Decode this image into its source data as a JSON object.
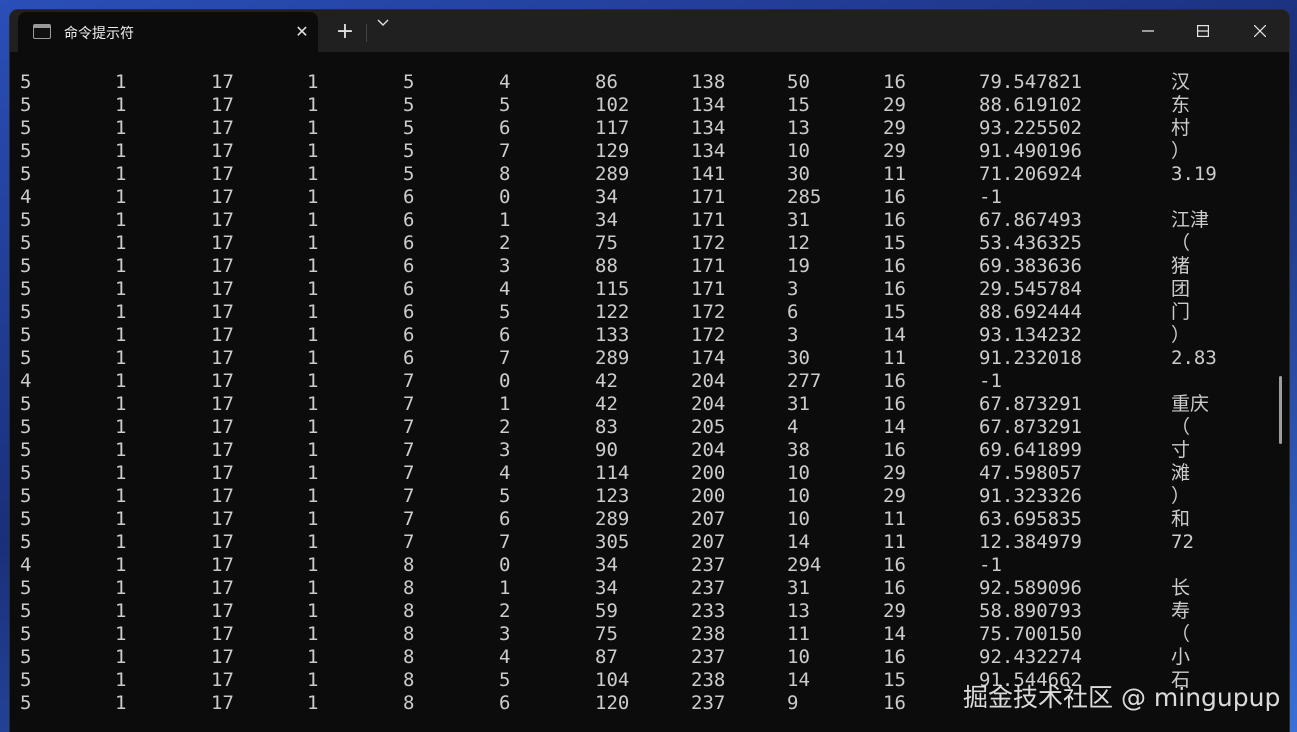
{
  "window": {
    "tab_title": "命令提示符",
    "new_tab": "+"
  },
  "watermark": "掘金技术社区 @ mingupup",
  "rows": [
    [
      "5",
      "1",
      "17",
      "1",
      "5",
      "4",
      "86",
      "138",
      "50",
      "16",
      "79.547821",
      "汉"
    ],
    [
      "5",
      "1",
      "17",
      "1",
      "5",
      "5",
      "102",
      "134",
      "15",
      "29",
      "88.619102",
      "东"
    ],
    [
      "5",
      "1",
      "17",
      "1",
      "5",
      "6",
      "117",
      "134",
      "13",
      "29",
      "93.225502",
      "村"
    ],
    [
      "5",
      "1",
      "17",
      "1",
      "5",
      "7",
      "129",
      "134",
      "10",
      "29",
      "91.490196",
      "）"
    ],
    [
      "5",
      "1",
      "17",
      "1",
      "5",
      "8",
      "289",
      "141",
      "30",
      "11",
      "71.206924",
      "3.19"
    ],
    [
      "4",
      "1",
      "17",
      "1",
      "6",
      "0",
      "34",
      "171",
      "285",
      "16",
      "-1",
      ""
    ],
    [
      "5",
      "1",
      "17",
      "1",
      "6",
      "1",
      "34",
      "171",
      "31",
      "16",
      "67.867493",
      "江津"
    ],
    [
      "5",
      "1",
      "17",
      "1",
      "6",
      "2",
      "75",
      "172",
      "12",
      "15",
      "53.436325",
      "（"
    ],
    [
      "5",
      "1",
      "17",
      "1",
      "6",
      "3",
      "88",
      "171",
      "19",
      "16",
      "69.383636",
      "猪"
    ],
    [
      "5",
      "1",
      "17",
      "1",
      "6",
      "4",
      "115",
      "171",
      "3",
      "16",
      "29.545784",
      "团"
    ],
    [
      "5",
      "1",
      "17",
      "1",
      "6",
      "5",
      "122",
      "172",
      "6",
      "15",
      "88.692444",
      "门"
    ],
    [
      "5",
      "1",
      "17",
      "1",
      "6",
      "6",
      "133",
      "172",
      "3",
      "14",
      "93.134232",
      "）"
    ],
    [
      "5",
      "1",
      "17",
      "1",
      "6",
      "7",
      "289",
      "174",
      "30",
      "11",
      "91.232018",
      "2.83"
    ],
    [
      "4",
      "1",
      "17",
      "1",
      "7",
      "0",
      "42",
      "204",
      "277",
      "16",
      "-1",
      ""
    ],
    [
      "5",
      "1",
      "17",
      "1",
      "7",
      "1",
      "42",
      "204",
      "31",
      "16",
      "67.873291",
      "重庆"
    ],
    [
      "5",
      "1",
      "17",
      "1",
      "7",
      "2",
      "83",
      "205",
      "4",
      "14",
      "67.873291",
      "（"
    ],
    [
      "5",
      "1",
      "17",
      "1",
      "7",
      "3",
      "90",
      "204",
      "38",
      "16",
      "69.641899",
      "寸"
    ],
    [
      "5",
      "1",
      "17",
      "1",
      "7",
      "4",
      "114",
      "200",
      "10",
      "29",
      "47.598057",
      "滩"
    ],
    [
      "5",
      "1",
      "17",
      "1",
      "7",
      "5",
      "123",
      "200",
      "10",
      "29",
      "91.323326",
      "）"
    ],
    [
      "5",
      "1",
      "17",
      "1",
      "7",
      "6",
      "289",
      "207",
      "10",
      "11",
      "63.695835",
      "和"
    ],
    [
      "5",
      "1",
      "17",
      "1",
      "7",
      "7",
      "305",
      "207",
      "14",
      "11",
      "12.384979",
      "72"
    ],
    [
      "4",
      "1",
      "17",
      "1",
      "8",
      "0",
      "34",
      "237",
      "294",
      "16",
      "-1",
      ""
    ],
    [
      "5",
      "1",
      "17",
      "1",
      "8",
      "1",
      "34",
      "237",
      "31",
      "16",
      "92.589096",
      "长"
    ],
    [
      "5",
      "1",
      "17",
      "1",
      "8",
      "2",
      "59",
      "233",
      "13",
      "29",
      "58.890793",
      "寿"
    ],
    [
      "5",
      "1",
      "17",
      "1",
      "8",
      "3",
      "75",
      "238",
      "11",
      "14",
      "75.700150",
      "（"
    ],
    [
      "5",
      "1",
      "17",
      "1",
      "8",
      "4",
      "87",
      "237",
      "10",
      "16",
      "92.432274",
      "小"
    ],
    [
      "5",
      "1",
      "17",
      "1",
      "8",
      "5",
      "104",
      "238",
      "14",
      "15",
      "91.544662",
      "石"
    ],
    [
      "5",
      "1",
      "17",
      "1",
      "8",
      "6",
      "120",
      "237",
      "9",
      "16",
      "",
      ""
    ]
  ]
}
